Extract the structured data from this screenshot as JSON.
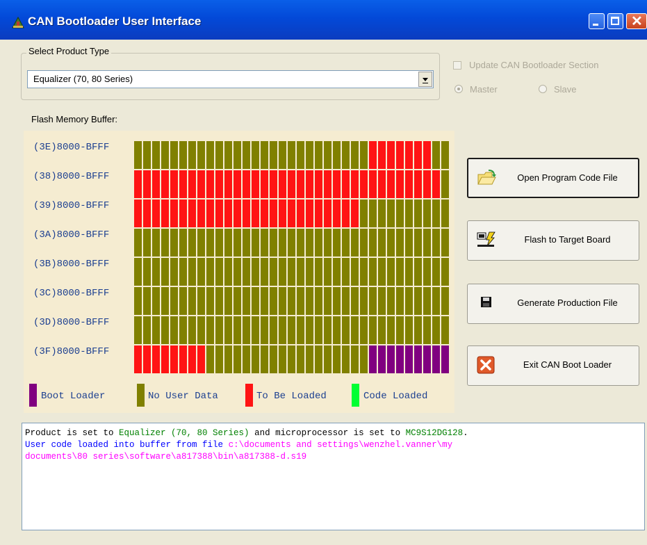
{
  "window": {
    "title": "CAN Bootloader User Interface",
    "controls": {
      "minimize_icon": "minimize-icon",
      "maximize_icon": "maximize-icon",
      "close_icon": "close-icon"
    }
  },
  "product": {
    "group_label": "Select Product Type",
    "selected": "Equalizer (70, 80 Series)"
  },
  "options": {
    "update_label": "Update CAN Bootloader Section",
    "update_checked": false,
    "master_label": "Master",
    "slave_label": "Slave",
    "selected_radio": "Master",
    "enabled": false
  },
  "flash_buffer": {
    "label": "Flash Memory Buffer:",
    "columns": 32,
    "rows": [
      {
        "label": "(3E)8000-BFFF",
        "cells": "NNNNNNNNNNNNNNNNNNNNNNNNNNLLLLLLLNN"
      },
      {
        "label": "(38)8000-BFFF",
        "cells": "LLLLLLLLLLLLLLLLLLLLLLLLLLLLLLLLLLN"
      },
      {
        "label": "(39)8000-BFFF",
        "cells": "LLLLLLLLLLLLLLLLLLLLLLLLLNNNNNNNNNN"
      },
      {
        "label": "(3A)8000-BFFF",
        "cells": "NNNNNNNNNNNNNNNNNNNNNNNNNNNNNNNNNNN"
      },
      {
        "label": "(3B)8000-BFFF",
        "cells": "NNNNNNNNNNNNNNNNNNNNNNNNNNNNNNNNNNN"
      },
      {
        "label": "(3C)8000-BFFF",
        "cells": "NNNNNNNNNNNNNNNNNNNNNNNNNNNNNNNNNNN"
      },
      {
        "label": "(3D)8000-BFFF",
        "cells": "NNNNNNNNNNNNNNNNNNNNNNNNNNNNNNNNNNN"
      },
      {
        "label": "(3F)8000-BFFF",
        "cells": "LLLLLLLLNNNNNNNNNNNNNNNNNNBBBBBBBBB"
      }
    ],
    "colors": {
      "B": "#800080",
      "N": "#808000",
      "L": "#ff1414",
      "C": "#00ff33"
    },
    "legend": [
      {
        "label": "Boot Loader",
        "color": "#800080"
      },
      {
        "label": "No User Data",
        "color": "#808000"
      },
      {
        "label": "To Be Loaded",
        "color": "#ff1414"
      },
      {
        "label": "Code Loaded",
        "color": "#00ff33"
      }
    ]
  },
  "actions": {
    "open": {
      "label": "Open Program Code File",
      "icon": "open-folder-icon"
    },
    "flash": {
      "label": "Flash to Target Board",
      "icon": "flash-chip-icon"
    },
    "generate": {
      "label": "Generate Production File",
      "icon": "save-disk-icon"
    },
    "exit": {
      "label": "Exit CAN Boot Loader",
      "icon": "exit-x-icon"
    }
  },
  "log": {
    "line1_a": "Product is set to ",
    "line1_product": "Equalizer (70, 80 Series)",
    "line1_b": " and microprocessor is set to ",
    "line1_mcu": "MC9S12DG128",
    "line1_c": ".",
    "line2_a": "User code loaded into buffer from file ",
    "line2_path_1": "c:\\documents and settings\\wenzhel.vanner\\my",
    "line3_path_2": "documents\\80 series\\software\\a817388\\bin\\a817388-d.s19"
  }
}
